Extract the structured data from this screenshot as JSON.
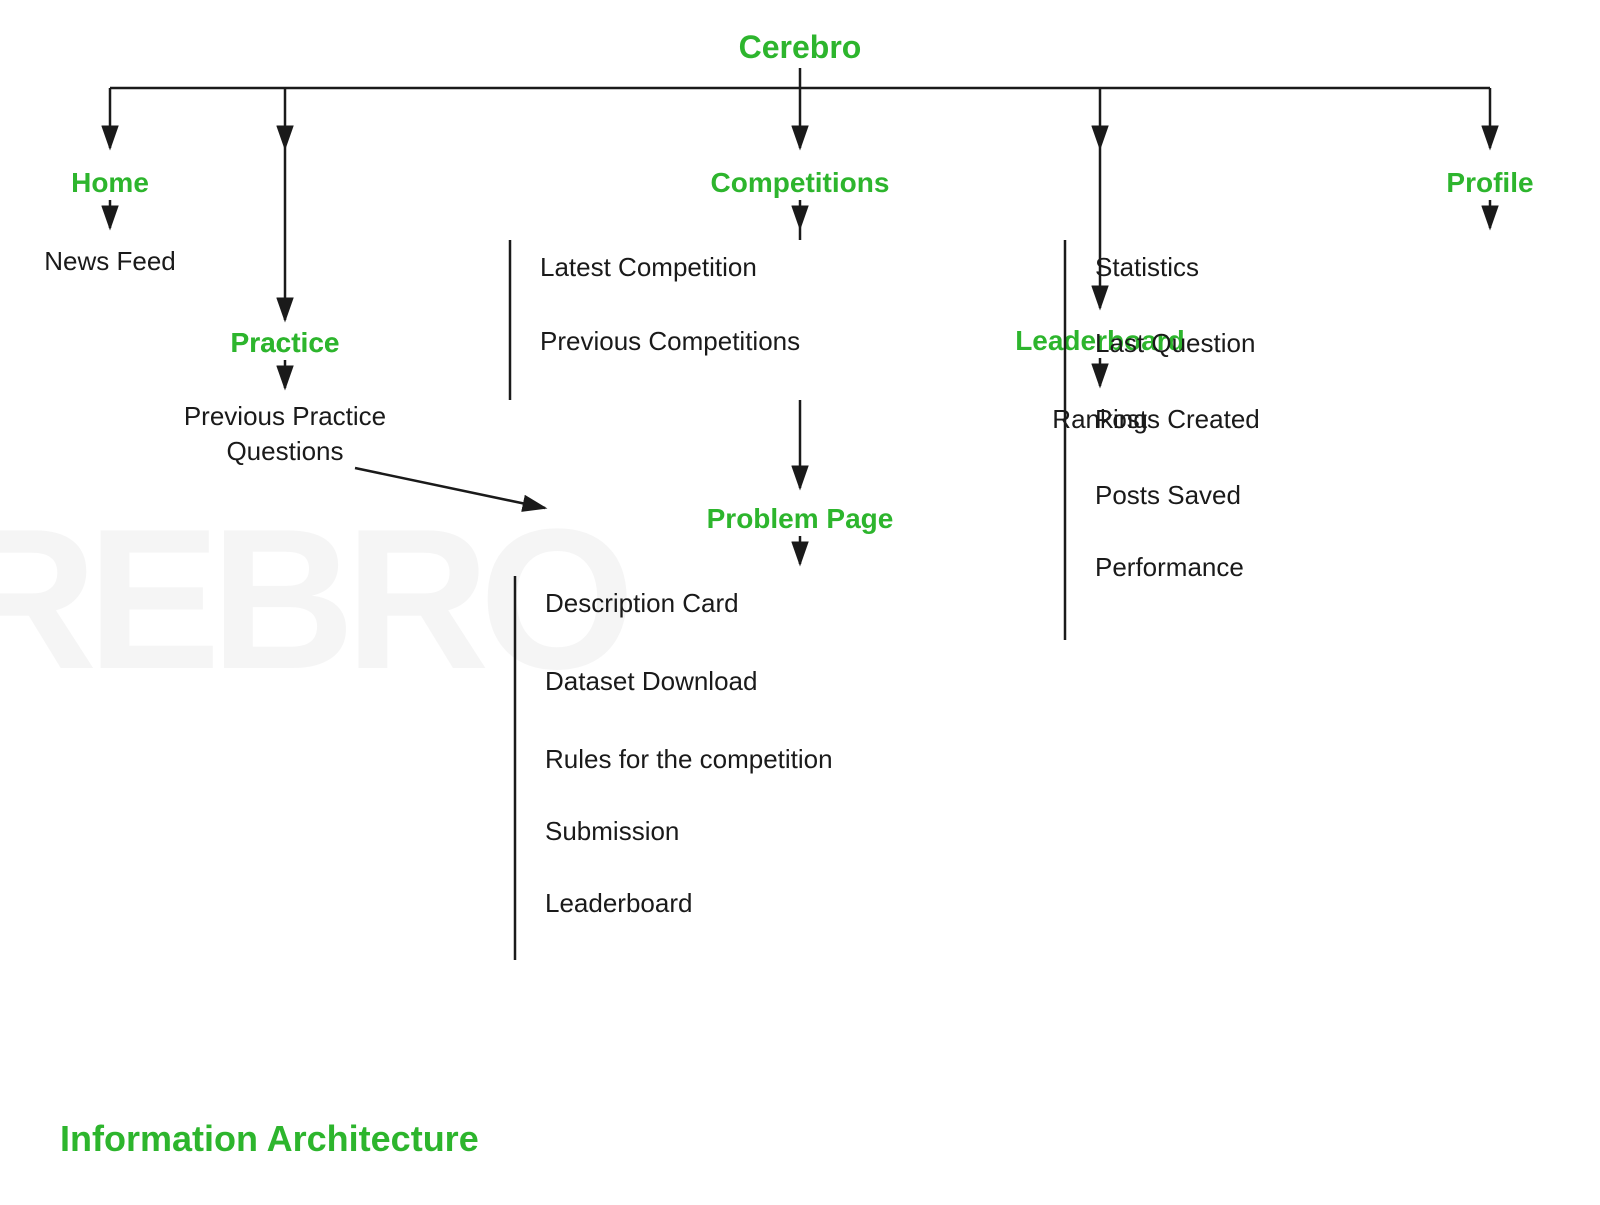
{
  "title": "Cerebro",
  "watermark": "CEREBRO",
  "bottom_label": "Information Architecture",
  "nodes": {
    "root": "Cerebro",
    "home": "Home",
    "news_feed": "News Feed",
    "practice": "Practice",
    "prev_practice": "Previous Practice",
    "questions": "Questions",
    "competitions": "Competitions",
    "latest_comp": "Latest  Competition",
    "prev_comp": "Previous Competitions",
    "problem_page": "Problem Page",
    "desc_card": "Description Card",
    "dataset": "Dataset Download",
    "rules": "Rules for the competition",
    "submission": "Submission",
    "leaderboard_sub": "Leaderboard",
    "leaderboard": "Leaderboard",
    "ranking": "Ranking",
    "profile": "Profile",
    "statistics": "Statistics",
    "last_question": "Last Question",
    "posts_created": "Posts Created",
    "posts_saved": "Posts Saved",
    "performance": "Performance"
  }
}
